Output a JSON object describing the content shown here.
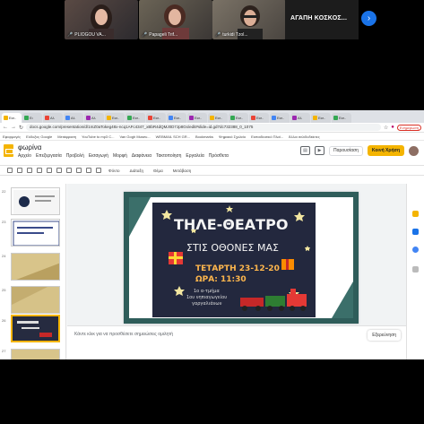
{
  "meeting": {
    "participants": [
      {
        "name": "PLIOGOU VA..."
      },
      {
        "name": "Papageli Trif..."
      },
      {
        "name": "turkidi Tzol..."
      }
    ],
    "text_tile_name": "ΑΓΑΠΗ ΚΟΣΚΟΣ...",
    "next_icon": "chevron-right-icon"
  },
  "browser": {
    "tabs": [
      "Εισ..",
      "Ει",
      "Αλ",
      "Αλ",
      "Αλ",
      "Εισ..",
      "Εισ..",
      "Εισ..",
      "Εισ..",
      "Εισ..",
      "Εισ..",
      "Εισ..",
      "Εισ..",
      "Εισ..",
      "Αλ",
      "Εισ..",
      "Εισ.."
    ],
    "url": "docs.google.com/presentation/d/1mZ0aTokeg48x-ncq1AFc4347_xBbR4dQMJ0D7Jp8Gs/edit#slide=id.gd7dc732388_0_1075",
    "bookmarks": [
      "Εφαρμογές",
      "Εύδοξος Google",
      "Μετάφραση",
      "YouTube to mp3 C...",
      "Van Gogh Museu...",
      "WEBMAIL SCH GR...",
      "Bookmarks",
      "Ψηφιακό Σχολείο",
      "Εκπαιδευτικό Πλαί...",
      "Άλλοι σελιδοδείκτες"
    ]
  },
  "app": {
    "title": "φωρίνα",
    "menu": [
      "Αρχείο",
      "Επεξεργασία",
      "Προβολή",
      "Εισαγωγή",
      "Μορφή",
      "Διαφάνεια",
      "Τακτοποίηση",
      "Εργαλεία",
      "Πρόσθετα"
    ],
    "present_label": "Παρουσίαση",
    "share_label": "Κοινή Χρήση",
    "toolbar": [
      "Φόντο",
      "Διάταξη",
      "Θέμα",
      "Μετάβαση"
    ]
  },
  "filmstrip": {
    "numbers": [
      "22",
      "23",
      "24",
      "25",
      "26",
      "27"
    ]
  },
  "slide": {
    "poster": {
      "title_line1": "ΤΗΛΕ-ΘΕΑΤΡΟ",
      "title_line2": "ΣΤΙΣ ΟΘΟΝΕΣ ΜΑΣ",
      "date_line": "ΤΕΤΑΡΤΗ 23-12-20",
      "time_line": "ΩΡΑ: 11:30",
      "footer": [
        "1ο α-τμήμα",
        "1ου νηπιαγωγείου",
        "γαργαλιάνων"
      ]
    }
  },
  "notes": {
    "placeholder": "Κάντε κλικ για να προσθέσετε σημειώσεις ομιλητή",
    "explore_label": "Εξερεύνηση"
  },
  "colors": {
    "accent": "#f4b400",
    "slide_border": "#2f5d5a",
    "poster_bg": "#23283e",
    "google_blue": "#1a73e8"
  }
}
